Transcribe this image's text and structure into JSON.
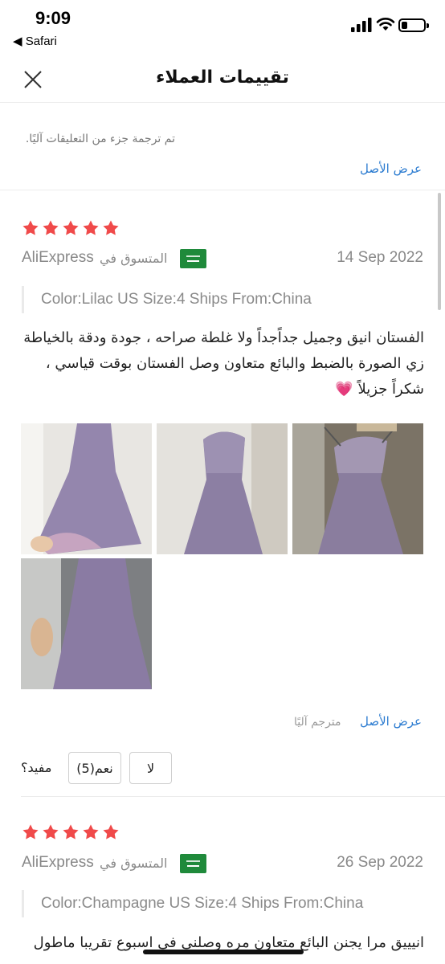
{
  "status_bar": {
    "time": "9:09",
    "back_app": "◀ Safari",
    "icons": [
      "signal-icon",
      "wifi-icon",
      "battery-icon"
    ]
  },
  "header": {
    "title": "تقييمات العملاء",
    "close_icon": "close-icon"
  },
  "notice": {
    "text": "تم ترجمة جزء من التعليقات آليًا.",
    "show_original": "عرض الأصل"
  },
  "reviews": [
    {
      "rating": 5,
      "date": "14 Sep 2022",
      "shopper_label": "المتسوق في",
      "source": "AliExpress",
      "country_flag": "saudi-arabia-flag",
      "sku": "Color:Lilac US Size:4 Ships From:China",
      "text": "الفستان انيق وجميل جداًجداً ولا غلطة صراحه ، جودة ودقة بالخياطة زي الصورة بالضبط والبائع متعاون وصل الفستان بوقت قياسي ، شكراً جزيلاً 💗",
      "photo_count": 4,
      "show_original": "عرض الأصل",
      "translated_label": "مترجم آليًا",
      "helpful_label": "مفيد؟",
      "yes_label": "نعم(5)",
      "no_label": "لا"
    },
    {
      "rating": 5,
      "date": "26 Sep 2022",
      "shopper_label": "المتسوق في",
      "source": "AliExpress",
      "country_flag": "saudi-arabia-flag",
      "sku": "Color:Champagne  US Size:4 Ships From:China",
      "text": "انيييق مرا يجنن البائع متعاون مره وصلني في اسبوع تقريبا ماطول"
    }
  ],
  "colors": {
    "star": "#f04a4a",
    "link": "#2b7bd0",
    "muted_text": "#888888",
    "flag_green": "#1f8a3b",
    "dress_purple": "#8c7fa3"
  }
}
